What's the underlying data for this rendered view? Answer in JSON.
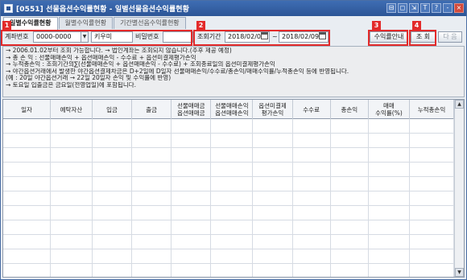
{
  "window": {
    "title": "[0551] 선물옵션수익률현황 - 일별선물옵션수익률현황",
    "buttons": [
      "⊟",
      "◻",
      "⇲",
      "T",
      "?",
      "-",
      "×"
    ]
  },
  "tabs": [
    {
      "label": "일별수익률현황",
      "active": true
    },
    {
      "label": "월별수익률현황",
      "active": false
    },
    {
      "label": "기간별선옵수익률현황",
      "active": false
    }
  ],
  "controls": {
    "account_label": "계좌번호",
    "account_value": "0000-0000",
    "account_name": "키우미",
    "password_label": "비밀번호",
    "period_label": "조회기간",
    "date_from": "2018/02/01",
    "tilde": "~",
    "date_to": "2018/02/09",
    "guide_button": "수익률안내",
    "search_button": "조 회",
    "next_button": "다 음"
  },
  "callouts": [
    "1",
    "2",
    "3",
    "4"
  ],
  "notes": [
    "→ 2006.01.02부터 조회 가능합니다. → 법인계좌는 조회되지 않습니다.(추후 제공 예정)",
    "→ 총  손  익 : 선물매매손익 + 옵션매매손익 - 수수료 + 옵션미결제평가손익",
    "→ 누적총손익 : 조회기간의∑(선물매매손익 + 옵션매매손익 - 수수료) + 조회종료일의 옵션미결제평가손익",
    "→ 야간옵션거래에서 발생한 야간옵션결제차금은 D+2일에 D일자 선물매매손익/수수료/총손익/매매수익률/누적총손익 등에 반영됩니다.",
    "    (예 : 20일 야간옵션거래 → 22일 20일자 손익 및 수익률에 반영)",
    "→ 토요일 입출금은 금요일(전영업일)에 포함됩니다."
  ],
  "grid": {
    "columns": [
      "일자",
      "예탁자산",
      "입금",
      "출금",
      "선물매매금\n옵션매매금",
      "선물매매손익\n옵션매매손익",
      "옵션미결제\n평가손익",
      "수수료",
      "총손익",
      "매매\n수익률(%)",
      "누적총손익"
    ],
    "rows": []
  }
}
